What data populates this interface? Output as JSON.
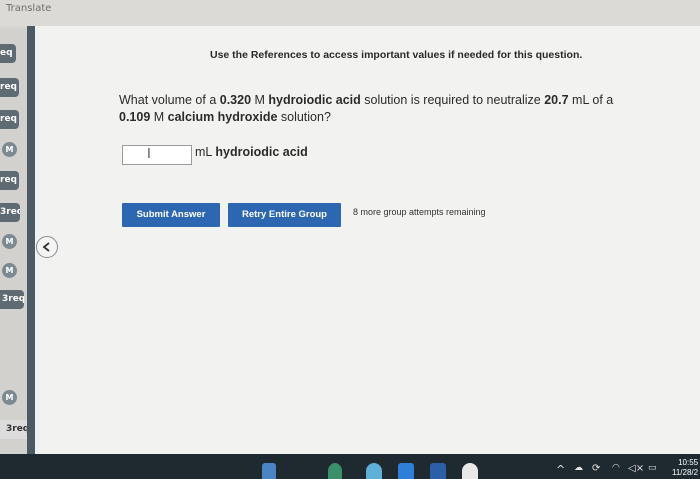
{
  "header": {
    "translate_label": "Translate"
  },
  "sidebar": {
    "items": [
      {
        "label": "eq",
        "kind": "req"
      },
      {
        "label": "req",
        "kind": "req"
      },
      {
        "label": "req",
        "kind": "req"
      },
      {
        "label": "M",
        "kind": "mastery"
      },
      {
        "label": "req",
        "kind": "req"
      },
      {
        "label": "3req",
        "kind": "req"
      },
      {
        "label": "M",
        "kind": "mastery"
      },
      {
        "label": "M",
        "kind": "mastery"
      },
      {
        "label": "3req",
        "kind": "req"
      },
      {
        "label": "M",
        "kind": "mastery"
      },
      {
        "label": "3req",
        "kind": "req"
      }
    ]
  },
  "main": {
    "references_text": "Use the References to access important values if needed for this question.",
    "question": {
      "p1": "What volume of a ",
      "conc1": "0.320",
      "p2": " M ",
      "acid": "hydroiodic acid",
      "p3": " solution is required to neutralize ",
      "vol": "20.7",
      "p4": " mL of a",
      "conc2": "0.109",
      "p5": " M ",
      "base": "calcium hydroxide",
      "p6": " solution?"
    },
    "answer": {
      "value": "",
      "unit_plain": "mL ",
      "unit_bold": "hydroiodic acid"
    },
    "buttons": {
      "submit": "Submit Answer",
      "retry": "Retry Entire Group"
    },
    "attempts_text": "8 more group attempts remaining"
  },
  "taskbar": {
    "time": "10:55",
    "date": "11/28/2"
  }
}
